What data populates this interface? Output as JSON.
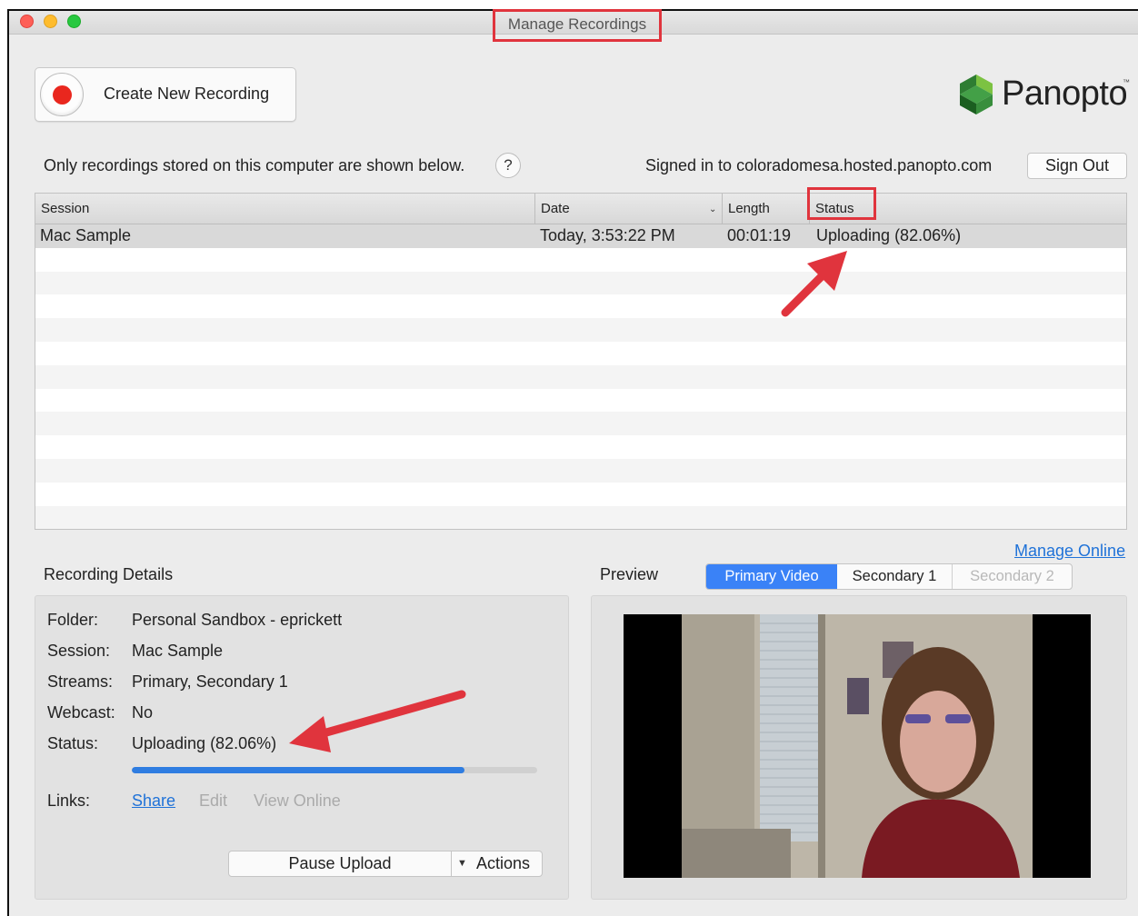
{
  "window": {
    "title": "Manage Recordings"
  },
  "toolbar": {
    "create_label": "Create New Recording"
  },
  "brand": {
    "logo_text": "Panopto",
    "logo_tm": "™",
    "accent": "#43a047"
  },
  "info": {
    "note": "Only recordings stored on this computer are shown below.",
    "help": "?",
    "signed_in": "Signed in to coloradomesa.hosted.panopto.com",
    "sign_out": "Sign Out"
  },
  "table": {
    "columns": {
      "session": "Session",
      "date": "Date",
      "length": "Length",
      "status": "Status"
    },
    "sort_indicator": "chevron-down-icon",
    "rows": [
      {
        "session": "Mac Sample",
        "date": "Today, 3:53:22 PM",
        "length": "00:01:19",
        "status": "Uploading (82.06%)"
      }
    ]
  },
  "manage_online": "Manage Online",
  "details": {
    "title": "Recording Details",
    "folder_label": "Folder:",
    "folder": "Personal Sandbox - eprickett",
    "session_label": "Session:",
    "session": "Mac Sample",
    "streams_label": "Streams:",
    "streams": "Primary, Secondary 1",
    "webcast_label": "Webcast:",
    "webcast": "No",
    "status_label": "Status:",
    "status": "Uploading (82.06%)",
    "progress_fraction": 0.82,
    "links_label": "Links:",
    "share": "Share",
    "edit": "Edit",
    "view_online": "View Online",
    "pause": "Pause Upload",
    "actions": "Actions"
  },
  "preview": {
    "title": "Preview",
    "tabs": [
      "Primary Video",
      "Secondary 1",
      "Secondary 2"
    ]
  },
  "annotation_color": "#e0343d"
}
